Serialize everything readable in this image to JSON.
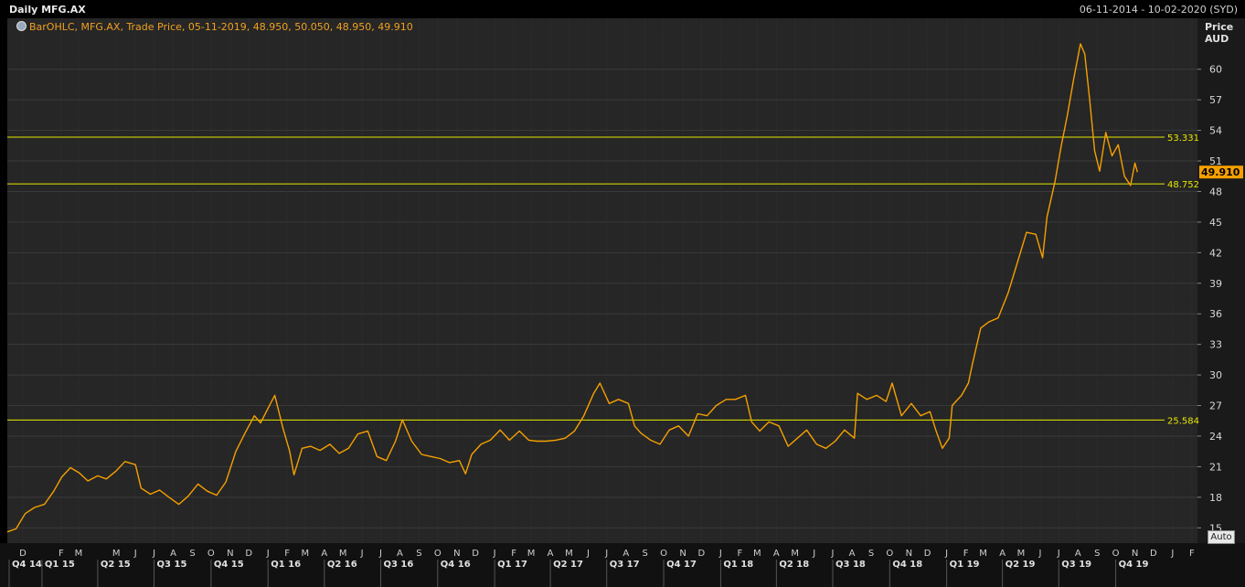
{
  "header": {
    "title": "Daily MFG.AX",
    "date_range": "06-11-2014 - 10-02-2020 (SYD)"
  },
  "legend": {
    "text": "BarOHLC, MFG.AX, Trade Price, 05-11-2019, 48.950, 50.050, 48.950, 49.910"
  },
  "axis": {
    "price_label": "Price",
    "currency_label": "AUD",
    "auto_label": "Auto"
  },
  "colors": {
    "series": "#f5a000",
    "level_line": "#e6e600",
    "last_price_bg": "#f5a000"
  },
  "chart_data": {
    "type": "line",
    "title": "Daily MFG.AX",
    "ylabel": "Price AUD",
    "ylim": [
      13.5,
      65
    ],
    "y_ticks": [
      15,
      18,
      21,
      24,
      27,
      30,
      33,
      36,
      39,
      42,
      45,
      48,
      51,
      54,
      57,
      60
    ],
    "x_range": [
      "2014-11-06",
      "2020-02-10"
    ],
    "last_price": "49.910",
    "levels": [
      {
        "value": 53.331,
        "label": "53.331"
      },
      {
        "value": 48.752,
        "label": "48.752"
      },
      {
        "value": 25.584,
        "label": "25.584"
      }
    ],
    "month_labels": [
      {
        "date": "2014-12-01",
        "label": "D"
      },
      {
        "date": "2015-02-01",
        "label": "F"
      },
      {
        "date": "2015-03-01",
        "label": "M"
      },
      {
        "date": "2015-05-01",
        "label": "M"
      },
      {
        "date": "2015-06-01",
        "label": "J"
      },
      {
        "date": "2015-07-01",
        "label": "J"
      },
      {
        "date": "2015-08-01",
        "label": "A"
      },
      {
        "date": "2015-09-01",
        "label": "S"
      },
      {
        "date": "2015-10-01",
        "label": "O"
      },
      {
        "date": "2015-11-01",
        "label": "N"
      },
      {
        "date": "2015-12-01",
        "label": "D"
      },
      {
        "date": "2016-01-01",
        "label": "J"
      },
      {
        "date": "2016-02-01",
        "label": "F"
      },
      {
        "date": "2016-03-01",
        "label": "M"
      },
      {
        "date": "2016-04-01",
        "label": "A"
      },
      {
        "date": "2016-05-01",
        "label": "M"
      },
      {
        "date": "2016-06-01",
        "label": "J"
      },
      {
        "date": "2016-07-01",
        "label": "J"
      },
      {
        "date": "2016-08-01",
        "label": "A"
      },
      {
        "date": "2016-09-01",
        "label": "S"
      },
      {
        "date": "2016-10-01",
        "label": "O"
      },
      {
        "date": "2016-11-01",
        "label": "N"
      },
      {
        "date": "2016-12-01",
        "label": "D"
      },
      {
        "date": "2017-01-01",
        "label": "J"
      },
      {
        "date": "2017-02-01",
        "label": "F"
      },
      {
        "date": "2017-03-01",
        "label": "M"
      },
      {
        "date": "2017-04-01",
        "label": "A"
      },
      {
        "date": "2017-05-01",
        "label": "M"
      },
      {
        "date": "2017-06-01",
        "label": "J"
      },
      {
        "date": "2017-07-01",
        "label": "J"
      },
      {
        "date": "2017-08-01",
        "label": "A"
      },
      {
        "date": "2017-09-01",
        "label": "S"
      },
      {
        "date": "2017-10-01",
        "label": "O"
      },
      {
        "date": "2017-11-01",
        "label": "N"
      },
      {
        "date": "2017-12-01",
        "label": "D"
      },
      {
        "date": "2018-01-01",
        "label": "J"
      },
      {
        "date": "2018-02-01",
        "label": "F"
      },
      {
        "date": "2018-03-01",
        "label": "M"
      },
      {
        "date": "2018-04-01",
        "label": "A"
      },
      {
        "date": "2018-05-01",
        "label": "M"
      },
      {
        "date": "2018-06-01",
        "label": "J"
      },
      {
        "date": "2018-07-01",
        "label": "J"
      },
      {
        "date": "2018-08-01",
        "label": "A"
      },
      {
        "date": "2018-09-01",
        "label": "S"
      },
      {
        "date": "2018-10-01",
        "label": "O"
      },
      {
        "date": "2018-11-01",
        "label": "N"
      },
      {
        "date": "2018-12-01",
        "label": "D"
      },
      {
        "date": "2019-01-01",
        "label": "J"
      },
      {
        "date": "2019-02-01",
        "label": "F"
      },
      {
        "date": "2019-03-01",
        "label": "M"
      },
      {
        "date": "2019-04-01",
        "label": "A"
      },
      {
        "date": "2019-05-01",
        "label": "M"
      },
      {
        "date": "2019-06-01",
        "label": "J"
      },
      {
        "date": "2019-07-01",
        "label": "J"
      },
      {
        "date": "2019-08-01",
        "label": "A"
      },
      {
        "date": "2019-09-01",
        "label": "S"
      },
      {
        "date": "2019-10-01",
        "label": "O"
      },
      {
        "date": "2019-11-01",
        "label": "N"
      },
      {
        "date": "2019-12-01",
        "label": "D"
      },
      {
        "date": "2020-01-01",
        "label": "J"
      },
      {
        "date": "2020-02-01",
        "label": "F"
      }
    ],
    "quarter_labels": [
      {
        "date": "2014-11-03",
        "label": "Q4 14"
      },
      {
        "date": "2015-01-01",
        "label": "Q1 15"
      },
      {
        "date": "2015-04-01",
        "label": "Q2 15"
      },
      {
        "date": "2015-07-01",
        "label": "Q3 15"
      },
      {
        "date": "2015-10-01",
        "label": "Q4 15"
      },
      {
        "date": "2016-01-01",
        "label": "Q1 16"
      },
      {
        "date": "2016-04-01",
        "label": "Q2 16"
      },
      {
        "date": "2016-07-01",
        "label": "Q3 16"
      },
      {
        "date": "2016-10-01",
        "label": "Q4 16"
      },
      {
        "date": "2017-01-01",
        "label": "Q1 17"
      },
      {
        "date": "2017-04-01",
        "label": "Q2 17"
      },
      {
        "date": "2017-07-01",
        "label": "Q3 17"
      },
      {
        "date": "2017-10-01",
        "label": "Q4 17"
      },
      {
        "date": "2018-01-01",
        "label": "Q1 18"
      },
      {
        "date": "2018-04-01",
        "label": "Q2 18"
      },
      {
        "date": "2018-07-01",
        "label": "Q3 18"
      },
      {
        "date": "2018-10-01",
        "label": "Q4 18"
      },
      {
        "date": "2019-01-01",
        "label": "Q1 19"
      },
      {
        "date": "2019-04-01",
        "label": "Q2 19"
      },
      {
        "date": "2019-07-01",
        "label": "Q3 19"
      },
      {
        "date": "2019-10-01",
        "label": "Q4 19"
      }
    ],
    "series": [
      {
        "points": [
          [
            "2014-11-06",
            14.6
          ],
          [
            "2014-11-20",
            14.9
          ],
          [
            "2014-12-05",
            16.4
          ],
          [
            "2014-12-20",
            17.0
          ],
          [
            "2015-01-05",
            17.3
          ],
          [
            "2015-01-20",
            18.6
          ],
          [
            "2015-02-02",
            20.0
          ],
          [
            "2015-02-16",
            20.9
          ],
          [
            "2015-03-02",
            20.4
          ],
          [
            "2015-03-16",
            19.6
          ],
          [
            "2015-04-01",
            20.1
          ],
          [
            "2015-04-15",
            19.8
          ],
          [
            "2015-05-01",
            20.6
          ],
          [
            "2015-05-15",
            21.5
          ],
          [
            "2015-06-01",
            21.2
          ],
          [
            "2015-06-10",
            18.9
          ],
          [
            "2015-06-25",
            18.3
          ],
          [
            "2015-07-10",
            18.7
          ],
          [
            "2015-07-25",
            18.0
          ],
          [
            "2015-08-10",
            17.3
          ],
          [
            "2015-08-25",
            18.1
          ],
          [
            "2015-09-10",
            19.3
          ],
          [
            "2015-09-25",
            18.6
          ],
          [
            "2015-10-10",
            18.2
          ],
          [
            "2015-10-25",
            19.5
          ],
          [
            "2015-11-10",
            22.5
          ],
          [
            "2015-11-25",
            24.3
          ],
          [
            "2015-12-10",
            26.0
          ],
          [
            "2015-12-20",
            25.3
          ],
          [
            "2016-01-05",
            27.2
          ],
          [
            "2016-01-12",
            28.0
          ],
          [
            "2016-01-25",
            24.8
          ],
          [
            "2016-02-05",
            22.5
          ],
          [
            "2016-02-12",
            20.2
          ],
          [
            "2016-02-25",
            22.8
          ],
          [
            "2016-03-10",
            23.0
          ],
          [
            "2016-03-25",
            22.6
          ],
          [
            "2016-04-10",
            23.2
          ],
          [
            "2016-04-25",
            22.3
          ],
          [
            "2016-05-10",
            22.8
          ],
          [
            "2016-05-25",
            24.2
          ],
          [
            "2016-06-10",
            24.5
          ],
          [
            "2016-06-25",
            22.0
          ],
          [
            "2016-07-10",
            21.6
          ],
          [
            "2016-07-25",
            23.5
          ],
          [
            "2016-08-05",
            25.6
          ],
          [
            "2016-08-20",
            23.5
          ],
          [
            "2016-09-05",
            22.2
          ],
          [
            "2016-09-20",
            22.0
          ],
          [
            "2016-10-05",
            21.8
          ],
          [
            "2016-10-20",
            21.4
          ],
          [
            "2016-11-05",
            21.6
          ],
          [
            "2016-11-15",
            20.3
          ],
          [
            "2016-11-25",
            22.2
          ],
          [
            "2016-12-10",
            23.2
          ],
          [
            "2016-12-25",
            23.6
          ],
          [
            "2017-01-10",
            24.6
          ],
          [
            "2017-01-25",
            23.6
          ],
          [
            "2017-02-10",
            24.5
          ],
          [
            "2017-02-25",
            23.6
          ],
          [
            "2017-03-10",
            23.5
          ],
          [
            "2017-03-25",
            23.5
          ],
          [
            "2017-04-10",
            23.6
          ],
          [
            "2017-04-25",
            23.8
          ],
          [
            "2017-05-10",
            24.5
          ],
          [
            "2017-05-25",
            26.0
          ],
          [
            "2017-06-10",
            28.2
          ],
          [
            "2017-06-20",
            29.2
          ],
          [
            "2017-07-05",
            27.2
          ],
          [
            "2017-07-20",
            27.6
          ],
          [
            "2017-08-05",
            27.2
          ],
          [
            "2017-08-15",
            25.0
          ],
          [
            "2017-08-25",
            24.3
          ],
          [
            "2017-09-10",
            23.6
          ],
          [
            "2017-09-25",
            23.2
          ],
          [
            "2017-10-10",
            24.6
          ],
          [
            "2017-10-25",
            25.0
          ],
          [
            "2017-11-10",
            24.0
          ],
          [
            "2017-11-25",
            26.2
          ],
          [
            "2017-12-10",
            26.0
          ],
          [
            "2017-12-25",
            27.0
          ],
          [
            "2018-01-10",
            27.6
          ],
          [
            "2018-01-25",
            27.6
          ],
          [
            "2018-02-10",
            28.0
          ],
          [
            "2018-02-20",
            25.4
          ],
          [
            "2018-03-05",
            24.5
          ],
          [
            "2018-03-20",
            25.4
          ],
          [
            "2018-04-05",
            25.0
          ],
          [
            "2018-04-20",
            23.0
          ],
          [
            "2018-05-05",
            23.8
          ],
          [
            "2018-05-20",
            24.6
          ],
          [
            "2018-06-05",
            23.2
          ],
          [
            "2018-06-20",
            22.8
          ],
          [
            "2018-07-05",
            23.5
          ],
          [
            "2018-07-20",
            24.6
          ],
          [
            "2018-08-05",
            23.8
          ],
          [
            "2018-08-10",
            28.2
          ],
          [
            "2018-08-25",
            27.6
          ],
          [
            "2018-09-10",
            28.0
          ],
          [
            "2018-09-25",
            27.4
          ],
          [
            "2018-10-05",
            29.2
          ],
          [
            "2018-10-20",
            26.0
          ],
          [
            "2018-11-05",
            27.2
          ],
          [
            "2018-11-20",
            26.0
          ],
          [
            "2018-12-05",
            26.4
          ],
          [
            "2018-12-15",
            24.5
          ],
          [
            "2018-12-25",
            22.8
          ],
          [
            "2019-01-05",
            23.8
          ],
          [
            "2019-01-10",
            27.0
          ],
          [
            "2019-01-25",
            28.0
          ],
          [
            "2019-02-05",
            29.2
          ],
          [
            "2019-02-12",
            31.2
          ],
          [
            "2019-02-25",
            34.6
          ],
          [
            "2019-03-10",
            35.2
          ],
          [
            "2019-03-25",
            35.6
          ],
          [
            "2019-04-10",
            38.0
          ],
          [
            "2019-04-25",
            41.0
          ],
          [
            "2019-05-10",
            44.0
          ],
          [
            "2019-05-25",
            43.8
          ],
          [
            "2019-06-05",
            41.5
          ],
          [
            "2019-06-12",
            45.5
          ],
          [
            "2019-06-25",
            49.0
          ],
          [
            "2019-07-05",
            52.5
          ],
          [
            "2019-07-15",
            55.5
          ],
          [
            "2019-07-25",
            59.0
          ],
          [
            "2019-08-05",
            62.5
          ],
          [
            "2019-08-12",
            61.5
          ],
          [
            "2019-08-20",
            57.0
          ],
          [
            "2019-08-28",
            52.0
          ],
          [
            "2019-09-05",
            50.0
          ],
          [
            "2019-09-15",
            53.8
          ],
          [
            "2019-09-25",
            51.5
          ],
          [
            "2019-10-05",
            52.6
          ],
          [
            "2019-10-15",
            49.5
          ],
          [
            "2019-10-25",
            48.6
          ],
          [
            "2019-11-01",
            50.8
          ],
          [
            "2019-11-05",
            49.9
          ]
        ]
      }
    ]
  }
}
